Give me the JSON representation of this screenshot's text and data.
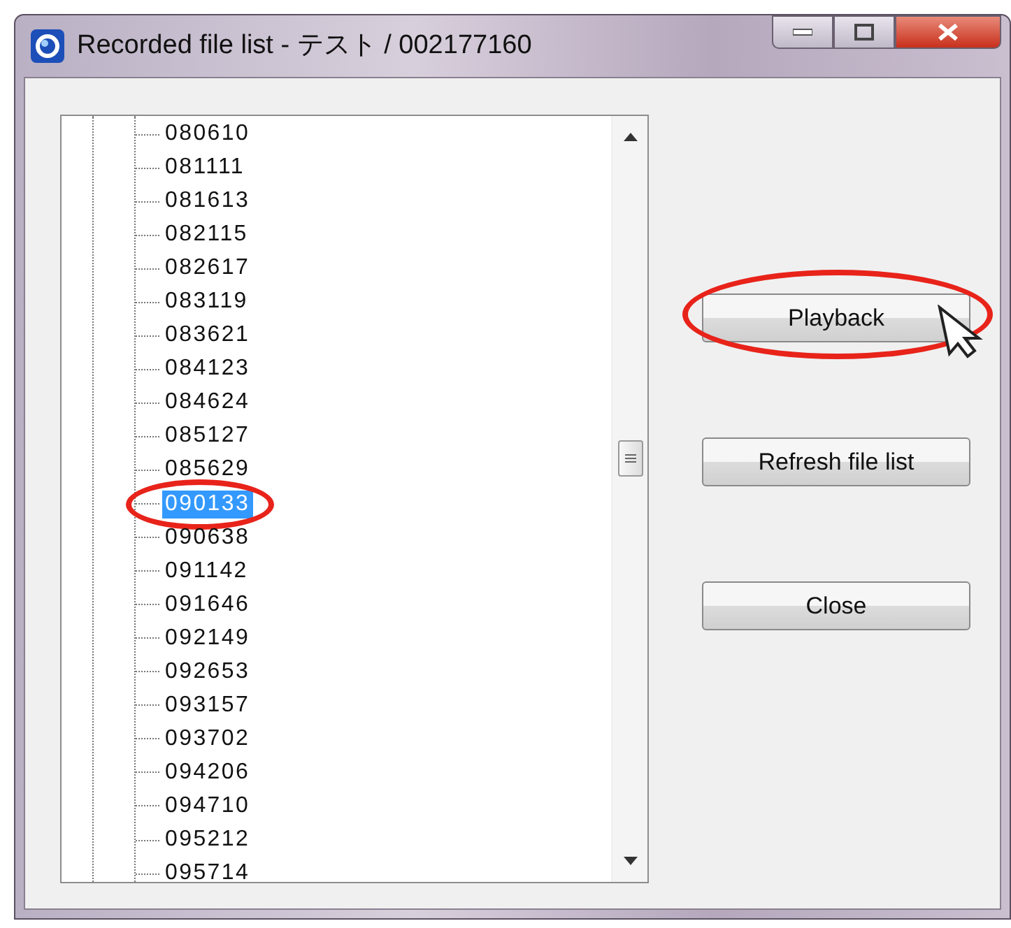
{
  "window": {
    "title": "Recorded file list - テスト / 002177160"
  },
  "tree": {
    "items": [
      {
        "label": "080610",
        "selected": false,
        "highlighted": false
      },
      {
        "label": "081111",
        "selected": false,
        "highlighted": false
      },
      {
        "label": "081613",
        "selected": false,
        "highlighted": false
      },
      {
        "label": "082115",
        "selected": false,
        "highlighted": false
      },
      {
        "label": "082617",
        "selected": false,
        "highlighted": false
      },
      {
        "label": "083119",
        "selected": false,
        "highlighted": false
      },
      {
        "label": "083621",
        "selected": false,
        "highlighted": false
      },
      {
        "label": "084123",
        "selected": false,
        "highlighted": false
      },
      {
        "label": "084624",
        "selected": false,
        "highlighted": false
      },
      {
        "label": "085127",
        "selected": false,
        "highlighted": false
      },
      {
        "label": "085629",
        "selected": false,
        "highlighted": false
      },
      {
        "label": "090133",
        "selected": true,
        "highlighted": true
      },
      {
        "label": "090638",
        "selected": false,
        "highlighted": false
      },
      {
        "label": "091142",
        "selected": false,
        "highlighted": false
      },
      {
        "label": "091646",
        "selected": false,
        "highlighted": false
      },
      {
        "label": "092149",
        "selected": false,
        "highlighted": false
      },
      {
        "label": "092653",
        "selected": false,
        "highlighted": false
      },
      {
        "label": "093157",
        "selected": false,
        "highlighted": false
      },
      {
        "label": "093702",
        "selected": false,
        "highlighted": false
      },
      {
        "label": "094206",
        "selected": false,
        "highlighted": false
      },
      {
        "label": "094710",
        "selected": false,
        "highlighted": false
      },
      {
        "label": "095212",
        "selected": false,
        "highlighted": false
      },
      {
        "label": "095714",
        "selected": false,
        "highlighted": false
      }
    ]
  },
  "buttons": [
    {
      "label": "Playback",
      "highlighted": true
    },
    {
      "label": "Refresh file list",
      "highlighted": false
    },
    {
      "label": "Close",
      "highlighted": false
    }
  ]
}
